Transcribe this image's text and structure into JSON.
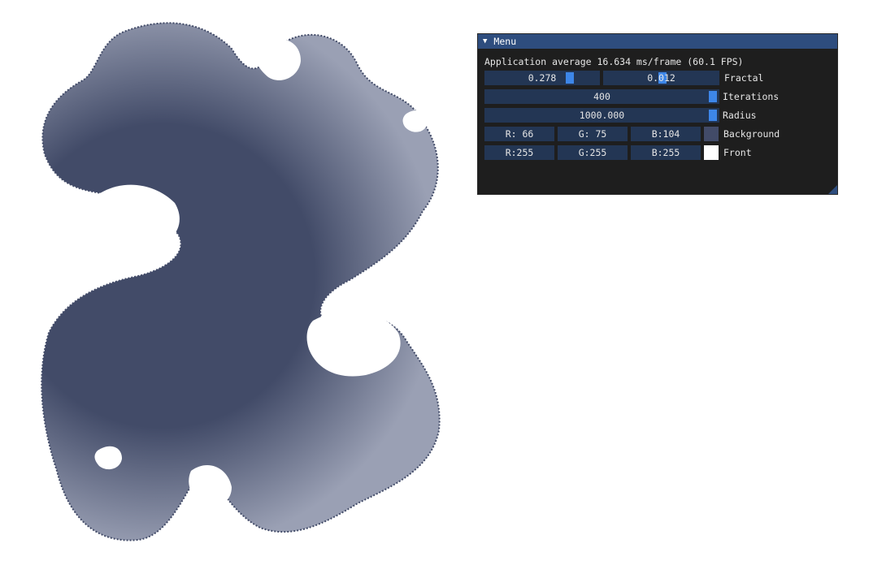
{
  "canvas": {
    "background_color": "#ffffff",
    "fractal_color": "#424b68",
    "fractal_highlight": "#9aa0b4"
  },
  "menu": {
    "title": "Menu",
    "collapse_icon": "triangle-down-icon",
    "fps_text": "Application average 16.634 ms/frame (60.1 FPS)",
    "fractal": {
      "label": "Fractal",
      "value_1": "0.278",
      "value_1_fraction": 0.7,
      "value_2": "0.012",
      "value_2_fraction": 0.51
    },
    "iterations": {
      "label": "Iterations",
      "value": "400",
      "fraction": 1.0
    },
    "radius": {
      "label": "Radius",
      "value": "1000.000",
      "fraction": 1.0
    },
    "background": {
      "label": "Background",
      "r": "R: 66",
      "g": "G: 75",
      "b": "B:104",
      "color": "#424b68"
    },
    "front": {
      "label": "Front",
      "r": "R:255",
      "g": "G:255",
      "b": "B:255",
      "color": "#ffffff"
    }
  }
}
